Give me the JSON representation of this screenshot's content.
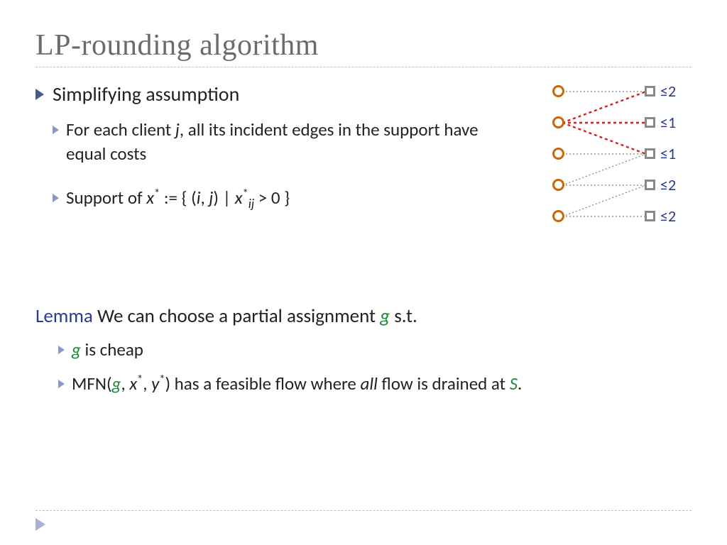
{
  "title": "LP-rounding algorithm",
  "bullets": {
    "b1": "Simplifying assumption",
    "b1_sub1_a": "For each client ",
    "b1_sub1_j": "j",
    "b1_sub1_b": ", all its incident edges in the support have equal costs",
    "b1_sub2_a": "Support of ",
    "b1_sub2_x": "x",
    "b1_sub2_star1": "*",
    "b1_sub2_b": " := { (",
    "b1_sub2_i": "i",
    "b1_sub2_c": ", ",
    "b1_sub2_j2": "j",
    "b1_sub2_d": ") | ",
    "b1_sub2_x2": "x",
    "b1_sub2_star2": "*",
    "b1_sub2_ij": "ij",
    "b1_sub2_e": " > 0 }"
  },
  "lemma": {
    "word": "Lemma",
    "line1_a": " We can choose a partial assignment ",
    "line1_g": "g",
    "line1_b": " s.t.",
    "sub1_g": "g",
    "sub1_b": " is cheap",
    "sub2_a": "MFN(",
    "sub2_g": "g",
    "sub2_b": ", ",
    "sub2_x": "x",
    "sub2_star1": "*",
    "sub2_c": ", ",
    "sub2_y": "y",
    "sub2_star2": "*",
    "sub2_d": ") has a feasible flow where ",
    "sub2_all": "all",
    "sub2_e": " flow is drained at ",
    "sub2_s": "S",
    "sub2_f": "."
  },
  "caps": {
    "c1": "≤2",
    "c2": "≤1",
    "c3": "≤1",
    "c4": "≤2",
    "c5": "≤2"
  }
}
